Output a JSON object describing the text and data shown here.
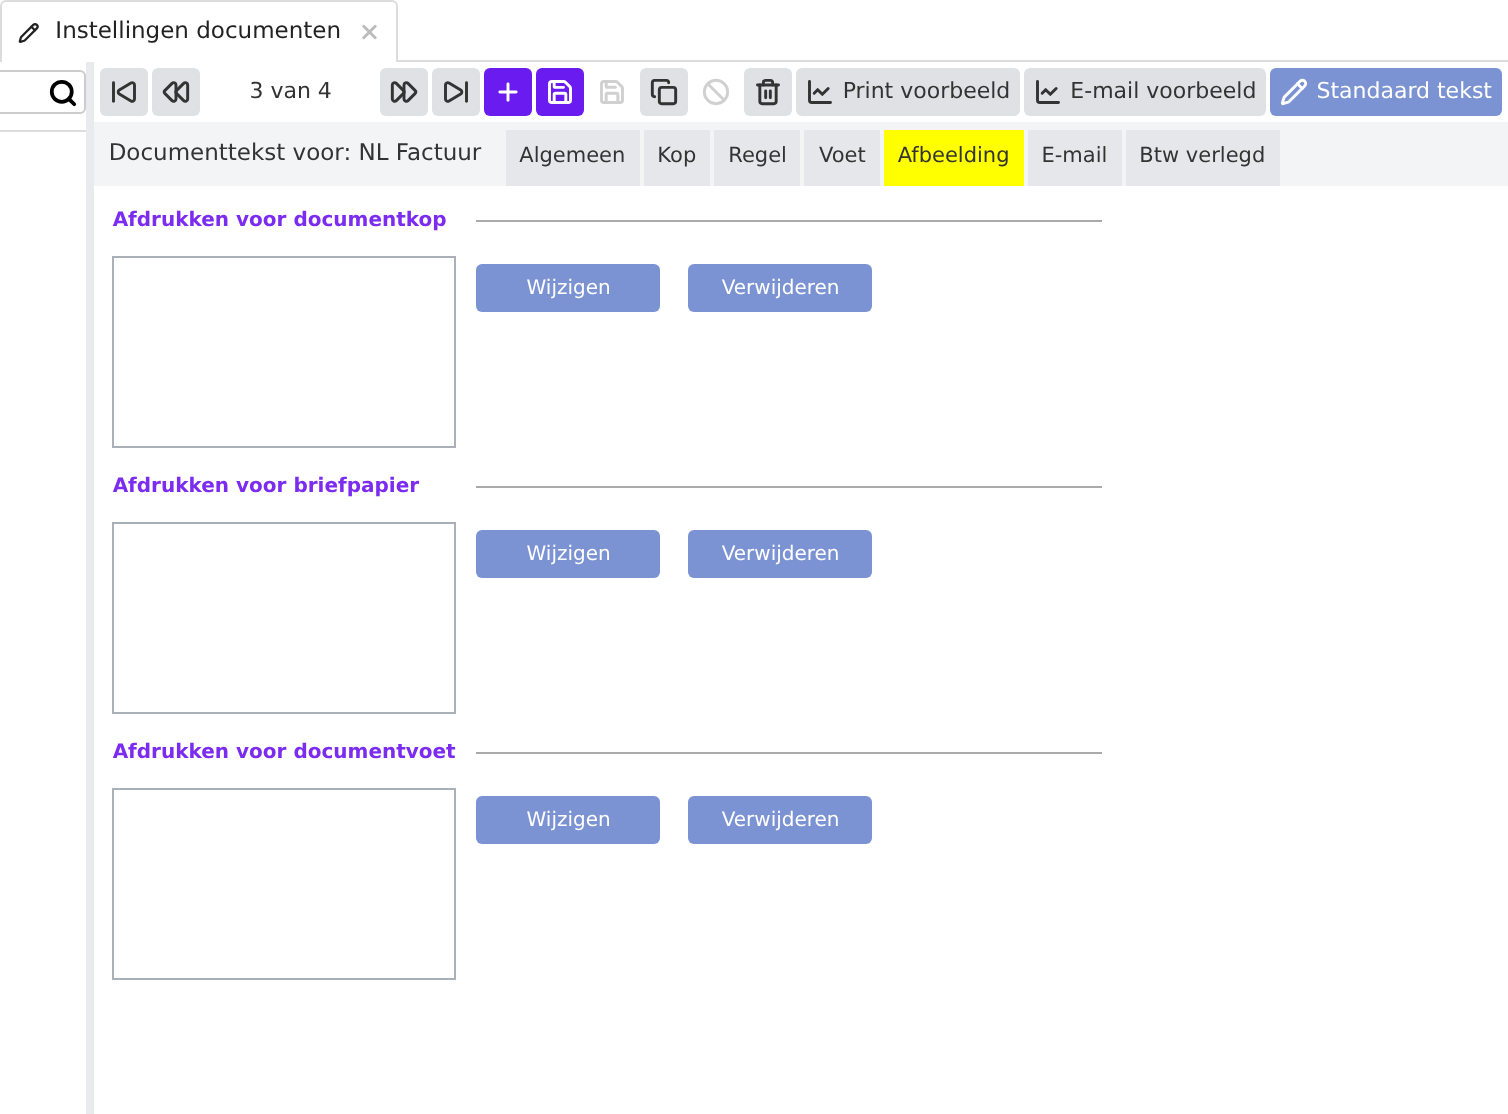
{
  "doc_tab": {
    "title": "Instellingen documenten"
  },
  "toolbar": {
    "record": "3 van 4",
    "buttons": [
      {
        "kind": "first",
        "disabled": false
      },
      {
        "kind": "prev",
        "disabled": false
      },
      {
        "kind": "record"
      },
      {
        "kind": "next",
        "disabled": false
      },
      {
        "kind": "last",
        "disabled": false
      },
      {
        "kind": "add",
        "disabled": false
      },
      {
        "kind": "save",
        "disabled": false
      },
      {
        "kind": "save-as",
        "disabled": true
      },
      {
        "kind": "copy",
        "disabled": false
      },
      {
        "kind": "cancel",
        "disabled": true
      },
      {
        "kind": "delete",
        "disabled": false
      },
      {
        "kind": "print",
        "label": "Print voorbeeld",
        "disabled": false
      },
      {
        "kind": "email",
        "label": "E-mail voorbeeld",
        "disabled": false
      },
      {
        "kind": "standard",
        "label": "Standaard tekst",
        "disabled": false
      }
    ]
  },
  "heading": "Documenttekst voor: NL Factuur",
  "tabs": [
    {
      "label": "Algemeen",
      "selected": false
    },
    {
      "label": "Kop",
      "selected": false
    },
    {
      "label": "Regel",
      "selected": false
    },
    {
      "label": "Voet",
      "selected": false
    },
    {
      "label": "Afbeelding",
      "selected": true
    },
    {
      "label": "E-mail",
      "selected": false
    },
    {
      "label": "Btw verlegd",
      "selected": false
    }
  ],
  "sections": [
    {
      "title": "Afdrukken voor documentkop",
      "buttons": [
        "Wijzigen",
        "Verwijderen"
      ]
    },
    {
      "title": "Afdrukken voor briefpapier",
      "buttons": [
        "Wijzigen",
        "Verwijderen"
      ]
    },
    {
      "title": "Afdrukken voor documentvoet",
      "buttons": [
        "Wijzigen",
        "Verwijderen"
      ]
    }
  ]
}
